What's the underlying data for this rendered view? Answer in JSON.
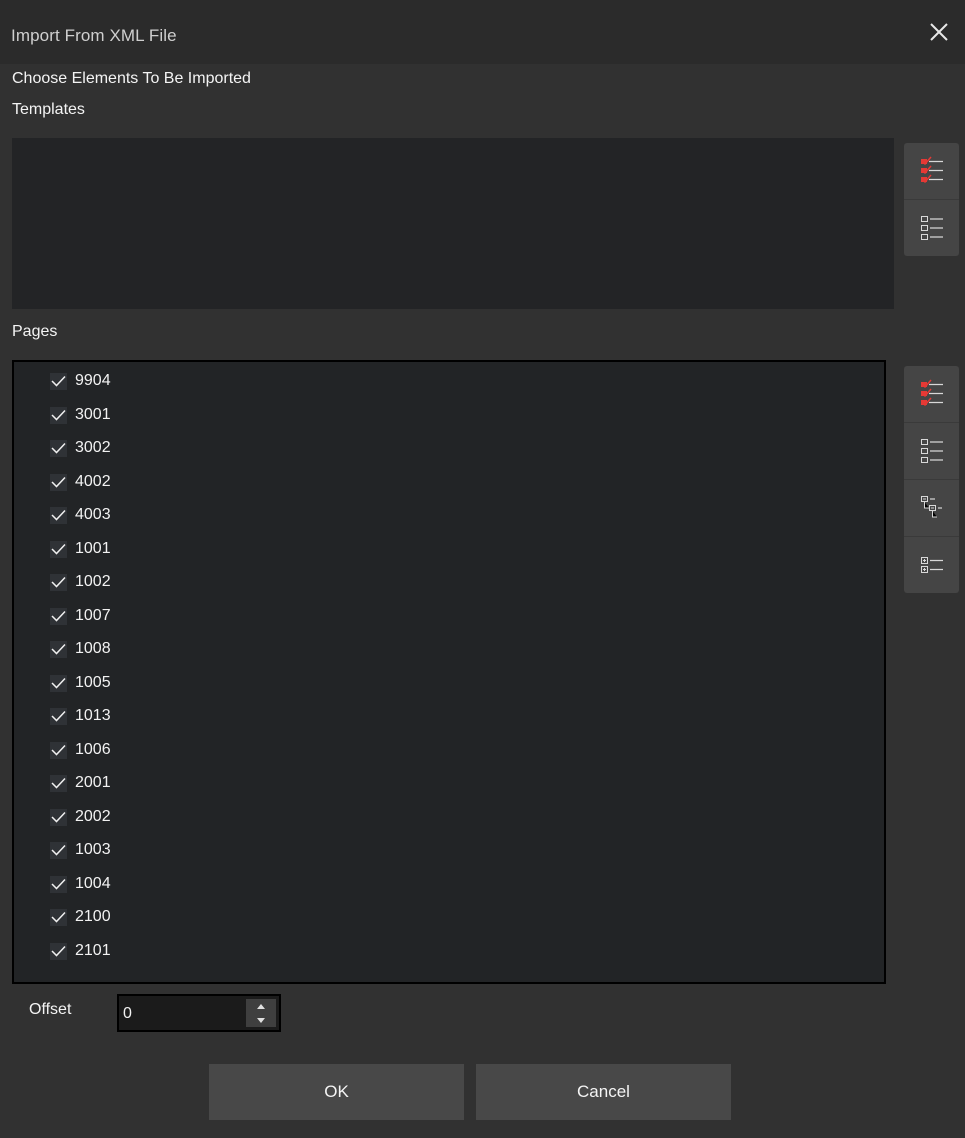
{
  "window": {
    "title": "Import From XML File"
  },
  "header": {
    "choose_label": "Choose Elements To Be Imported",
    "templates_label": "Templates"
  },
  "pages": {
    "label": "Pages",
    "items": [
      {
        "label": "9904",
        "checked": true
      },
      {
        "label": "3001",
        "checked": true
      },
      {
        "label": "3002",
        "checked": true
      },
      {
        "label": "4002",
        "checked": true
      },
      {
        "label": "4003",
        "checked": true
      },
      {
        "label": "1001",
        "checked": true
      },
      {
        "label": "1002",
        "checked": true
      },
      {
        "label": "1007",
        "checked": true
      },
      {
        "label": "1008",
        "checked": true
      },
      {
        "label": "1005",
        "checked": true
      },
      {
        "label": "1013",
        "checked": true
      },
      {
        "label": "1006",
        "checked": true
      },
      {
        "label": "2001",
        "checked": true
      },
      {
        "label": "2002",
        "checked": true
      },
      {
        "label": "1003",
        "checked": true
      },
      {
        "label": "1004",
        "checked": true
      },
      {
        "label": "2100",
        "checked": true
      },
      {
        "label": "2101",
        "checked": true
      }
    ]
  },
  "offset": {
    "label": "Offset",
    "value": "0"
  },
  "buttons": {
    "ok": "OK",
    "cancel": "Cancel"
  },
  "icons": {
    "close": "close-icon",
    "select_all": "select-all-icon",
    "deselect_all": "deselect-all-icon",
    "collapse_tree": "collapse-tree-icon",
    "expand_all": "expand-all-icon"
  },
  "colors": {
    "accent_red": "#e53935",
    "background": "#313131",
    "list_bg": "#222426"
  }
}
